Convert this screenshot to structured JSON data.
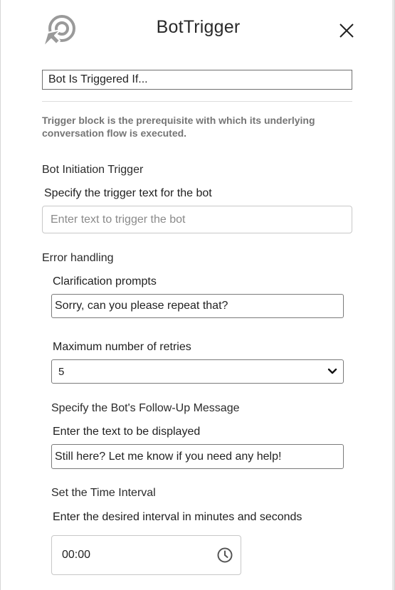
{
  "header": {
    "title": "BotTrigger",
    "logo_icon": "target-cursor-icon",
    "close_icon": "close-icon"
  },
  "trigger_name": {
    "value": "Bot Is Triggered If..."
  },
  "description": "Trigger block is the prerequisite with which its underlying conversation flow is executed.",
  "initiation": {
    "section_label": "Bot Initiation Trigger",
    "field_label": "Specify the trigger text for the bot",
    "placeholder": "Enter text to trigger the bot",
    "value": ""
  },
  "error_handling": {
    "section_label": "Error handling",
    "clarification_label": "Clarification prompts",
    "clarification_value": "Sorry, can you please repeat that?",
    "retries_label": "Maximum number of retries",
    "retries_value": "5"
  },
  "follow_up": {
    "section_label": "Specify the Bot's Follow-Up Message",
    "field_label": "Enter the text to be displayed",
    "value": "Still here? Let me know if you need any help!"
  },
  "time_interval": {
    "section_label": "Set the Time Interval",
    "field_label": "Enter the desired interval in minutes and seconds",
    "value": "00:00",
    "icon": "clock-icon"
  },
  "colors": {
    "icon_gray": "#9a9a9a",
    "text_dark": "#222222",
    "description_gray": "#757575"
  }
}
